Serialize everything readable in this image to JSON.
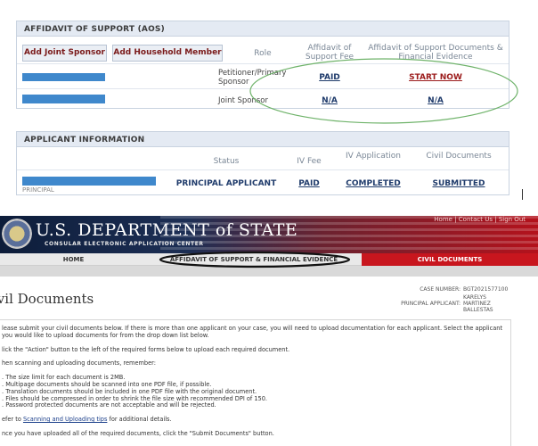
{
  "aos": {
    "title": "AFFIDAVIT OF SUPPORT (AOS)",
    "buttons": {
      "add_joint_sponsor": "Add Joint Sponsor",
      "add_household_member": "Add Household Member"
    },
    "headers": {
      "role": "Role",
      "fee": "Affidavit of Support Fee",
      "docs": "Affidavit of Support Documents & Financial Evidence"
    },
    "rows": [
      {
        "role": "Petitioner/Primary Sponsor",
        "fee": "PAID",
        "docs": "START NOW"
      },
      {
        "role": "Joint Sponsor",
        "fee": "N/A",
        "docs": "N/A"
      }
    ]
  },
  "applicant": {
    "title": "APPLICANT INFORMATION",
    "headers": {
      "status": "Status",
      "iv_fee": "IV Fee",
      "iv_application": "IV Application",
      "civil_documents": "Civil Documents"
    },
    "row": {
      "name_sub": "PRINCIPAL",
      "status": "PRINCIPAL APPLICANT",
      "iv_fee": "PAID",
      "iv_application": "COMPLETED",
      "civil_documents": "SUBMITTED"
    }
  },
  "site": {
    "brand": "U.S. DEPARTMENT of STATE",
    "brand_sub": "CONSULAR ELECTRONIC APPLICATION CENTER",
    "top_links": "Home  |  Contact Us  |  Sign Out",
    "nav": {
      "home": "HOME",
      "aos": "AFFIDAVIT OF SUPPORT & FINANCIAL EVIDENCE",
      "civil": "CIVIL DOCUMENTS"
    }
  },
  "civil": {
    "title": "ivil Documents",
    "case_number_label": "CASE NUMBER:",
    "case_number": "BGT2021577100",
    "principal_label": "PRINCIPAL APPLICANT:",
    "principal_name_1": "KARELYS",
    "principal_name_2": "MARTINEZ",
    "principal_name_3": "BALLESTAS",
    "p1": "lease submit your civil documents below. If there is more than one applicant on your case, you will need to upload documentation for each applicant. Select the applicant you would like to upload documents for from the drop down list below.",
    "p2": "lick the \"Action\" button to the left of the required forms below to upload each required document.",
    "p3": "hen scanning and uploading documents, remember:",
    "rules": [
      ". The size limit for each document is 2MB.",
      ". Multipage documents should be scanned into one PDF file, if possible.",
      ". Translation documents should be included in one PDF file with the original document.",
      ". Files should be compressed in order to shrink the file size with recommended DPI of 150.",
      ". Password protected documents are not acceptable and will be rejected."
    ],
    "p4_pre": "efer to ",
    "p4_link": "Scanning and Uploading tips",
    "p4_post": " for additional details.",
    "p5": "nce you have uploaded all of the required documents, click the \"Submit Documents\" button."
  },
  "colors": {
    "accent_blue": "#3f88cc",
    "nav_red": "#c8161e",
    "highlight_green": "#6fb36a"
  }
}
